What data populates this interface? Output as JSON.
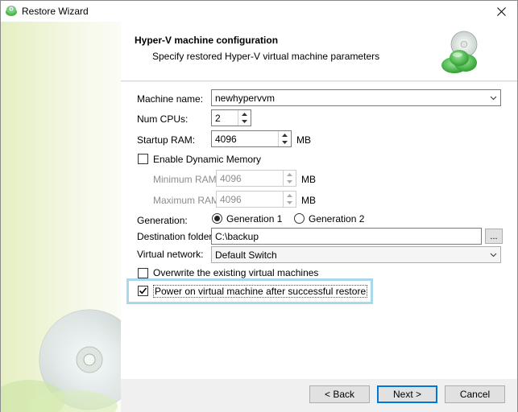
{
  "window": {
    "title": "Restore Wizard"
  },
  "header": {
    "title": "Hyper-V machine configuration",
    "subtitle": "Specify restored Hyper-V virtual machine parameters"
  },
  "form": {
    "machine_name": {
      "label": "Machine name:",
      "value": "newhypervvm"
    },
    "num_cpus": {
      "label": "Num CPUs:",
      "value": "2"
    },
    "startup_ram": {
      "label": "Startup RAM:",
      "value": "4096",
      "unit": "MB"
    },
    "dynamic_memory": {
      "label": "Enable Dynamic Memory",
      "checked": false
    },
    "minimum_ram": {
      "label": "Minimum RAM:",
      "value": "4096",
      "unit": "MB"
    },
    "maximum_ram": {
      "label": "Maximum RAM:",
      "value": "4096",
      "unit": "MB"
    },
    "generation": {
      "label": "Generation:",
      "options": [
        "Generation 1",
        "Generation 2"
      ],
      "selected": "Generation 1"
    },
    "destination_folder": {
      "label": "Destination folder:",
      "value": "C:\\backup",
      "browse_label": "..."
    },
    "virtual_network": {
      "label": "Virtual network:",
      "value": "Default Switch"
    },
    "overwrite": {
      "label": "Overwrite the existing virtual machines",
      "checked": false
    },
    "power_on": {
      "label": "Power on virtual machine after successful restore",
      "checked": true
    }
  },
  "footer": {
    "back_label": "< Back",
    "next_label": "Next >",
    "cancel_label": "Cancel"
  },
  "colors": {
    "highlight": "#a8d8ea",
    "default_button_border": "#0078d7",
    "icon_green": "#3fae3f"
  }
}
